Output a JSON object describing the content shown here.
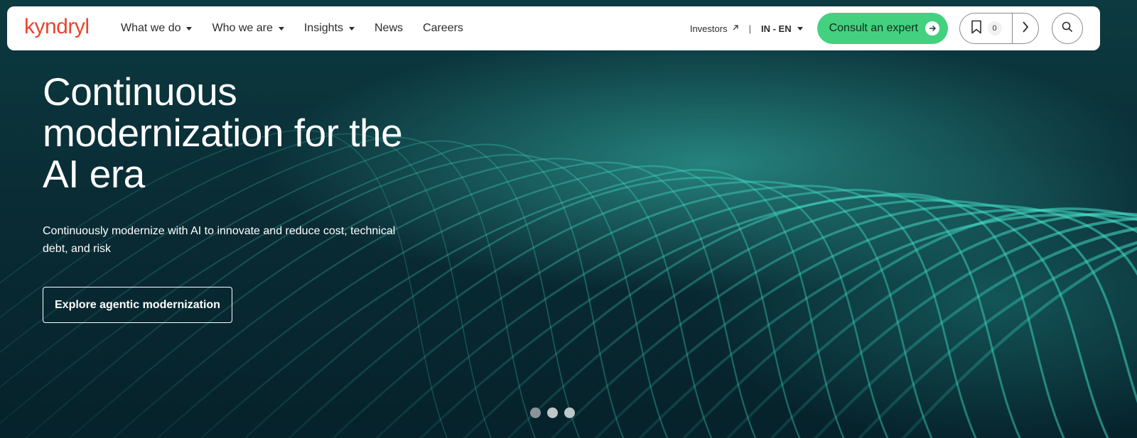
{
  "brand": {
    "logo_text": "kyndryl",
    "logo_color": "#e8452c"
  },
  "nav": {
    "items": [
      {
        "label": "What we do",
        "has_dropdown": true
      },
      {
        "label": "Who we are",
        "has_dropdown": true
      },
      {
        "label": "Insights",
        "has_dropdown": true
      },
      {
        "label": "News",
        "has_dropdown": false
      },
      {
        "label": "Careers",
        "has_dropdown": false
      }
    ],
    "investors_label": "Investors",
    "separator": "|",
    "language_label": "IN - EN",
    "consult_label": "Consult an expert",
    "consult_color": "#43d17f",
    "bookmark_count": "0"
  },
  "hero": {
    "headline": "Continuous modernization for the AI era",
    "subcopy": "Continuously modernize with AI to innovate and reduce cost, technical debt, and risk",
    "cta_label": "Explore agentic modernization"
  },
  "carousel": {
    "slide_count": 3,
    "active_index": 0
  },
  "icons": {
    "investors": "external-link-icon",
    "consult": "arrow-right-icon",
    "bookmark": "bookmark-icon",
    "next": "chevron-right-icon",
    "search": "search-icon"
  }
}
